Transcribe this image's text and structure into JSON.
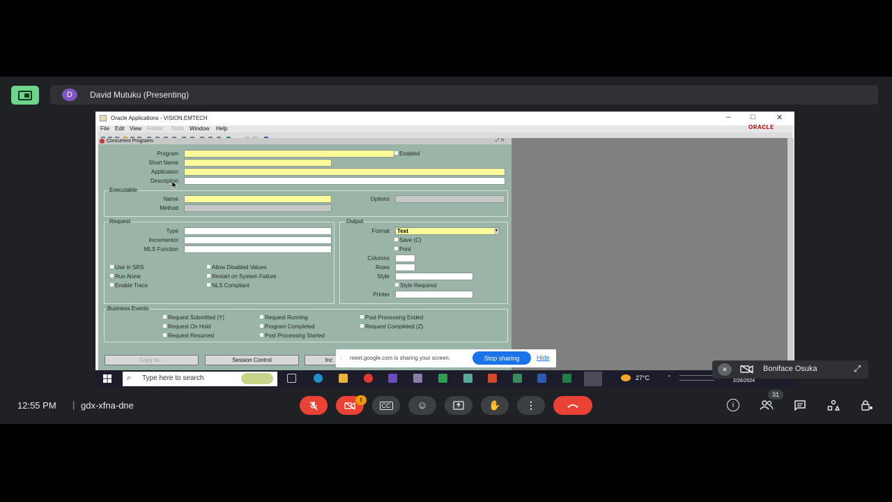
{
  "meet": {
    "presenter_initial": "D",
    "presenter_label": "David Mutuku (Presenting)",
    "clock": "12:55 PM",
    "separator": "|",
    "meeting_code": "gdx-xfna-dne",
    "participants_count": "31",
    "notification_badge": "!",
    "tile_name": "Boniface Osuka",
    "share_banner": {
      "text": "meet.google.com is sharing your screen.",
      "stop": "Stop sharing",
      "hide": "Hide"
    },
    "accent_red": "#ea4335",
    "accent_green": "#6dd58c"
  },
  "oracle": {
    "window_title": "Oracle Applications - VISION.EMTECH",
    "logo": "ORACLE",
    "menus": [
      "File",
      "Edit",
      "View",
      "Folder",
      "Tools",
      "Window",
      "Help"
    ],
    "form_title": "Concurrent Programs",
    "labels": {
      "program": "Program",
      "short_name": "Short Name",
      "application": "Application",
      "description": "Description",
      "executable": "Executable",
      "name": "Name",
      "method": "Method",
      "options": "Options",
      "request": "Request",
      "type": "Type",
      "incrementor": "Incrementor",
      "mls_function": "MLS Function",
      "output": "Output",
      "format": "Format",
      "columns": "Columns",
      "rows": "Rows",
      "style": "Style",
      "printer": "Printer",
      "business_events": "Business Events"
    },
    "enabled": "Enabled",
    "format_value": "Text",
    "output_checks": [
      "Save (C)",
      "Print",
      "Style Required"
    ],
    "request_checks": [
      "Use in SRS",
      "Run Alone",
      "Enable Trace",
      "Allow Disabled Values",
      "Restart on System Failure",
      "NLS Compliant"
    ],
    "event_checks": [
      "Request Submitted (Y)",
      "Request On Hold",
      "Request Resumed",
      "Request Running",
      "Program Completed",
      "Post Processing Started",
      "Post Processing Ended",
      "Request Completed (Z)"
    ],
    "buttons": {
      "copy_to": "Copy to...",
      "session_control": "Session Control",
      "incompatibilities": "Inc"
    }
  },
  "taskbar": {
    "search_placeholder": "Type here to search",
    "temperature": "27°C",
    "date": "2/26/2024"
  }
}
